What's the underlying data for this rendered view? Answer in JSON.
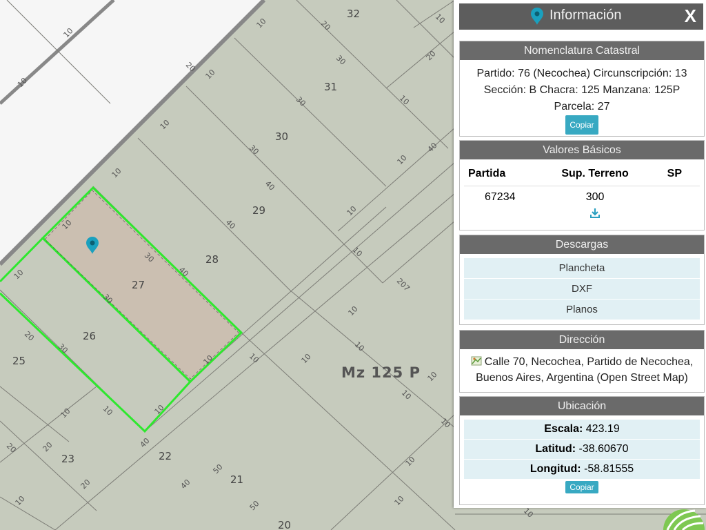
{
  "map": {
    "block_label": "Mz 125 P",
    "parcel_numbers": [
      "32",
      "31",
      "30",
      "29",
      "28",
      "27",
      "26",
      "25",
      "23",
      "22",
      "21",
      "20"
    ],
    "dimension_labels": [
      "10",
      "20",
      "30",
      "40",
      "50",
      "207"
    ],
    "colors": {
      "background": "#c6cbbd",
      "street": "#f6f6f6",
      "highlight": "#2ee82e",
      "selected_fill": "#cbbfb1",
      "marker": "#1aa0be"
    }
  },
  "panel": {
    "title": "Información",
    "close_label": "X",
    "nomenclatura": {
      "heading": "Nomenclatura Catastral",
      "line1": "Partido: 76 (Necochea) Circunscripción: 13",
      "line2": "Sección: B Chacra: 125 Manzana: 125P",
      "line3": "Parcela: 27",
      "copy_label": "Copiar"
    },
    "valores": {
      "heading": "Valores Básicos",
      "columns": [
        "Partida",
        "Sup. Terreno",
        "SP"
      ],
      "row": [
        "67234",
        "300",
        ""
      ],
      "download_icon": "download-icon"
    },
    "descargas": {
      "heading": "Descargas",
      "items": [
        "Plancheta",
        "DXF",
        "Planos"
      ]
    },
    "direccion": {
      "heading": "Dirección",
      "text": "Calle 70, Necochea, Partido de Necochea, Buenos Aires, Argentina (Open Street Map)",
      "icon": "map-icon"
    },
    "ubicacion": {
      "heading": "Ubicación",
      "escala_label": "Escala:",
      "escala_value": "423.19",
      "latitud_label": "Latitud:",
      "latitud_value": "-38.60670",
      "longitud_label": "Longitud:",
      "longitud_value": "-58.81555",
      "copy_label": "Copiar"
    }
  }
}
